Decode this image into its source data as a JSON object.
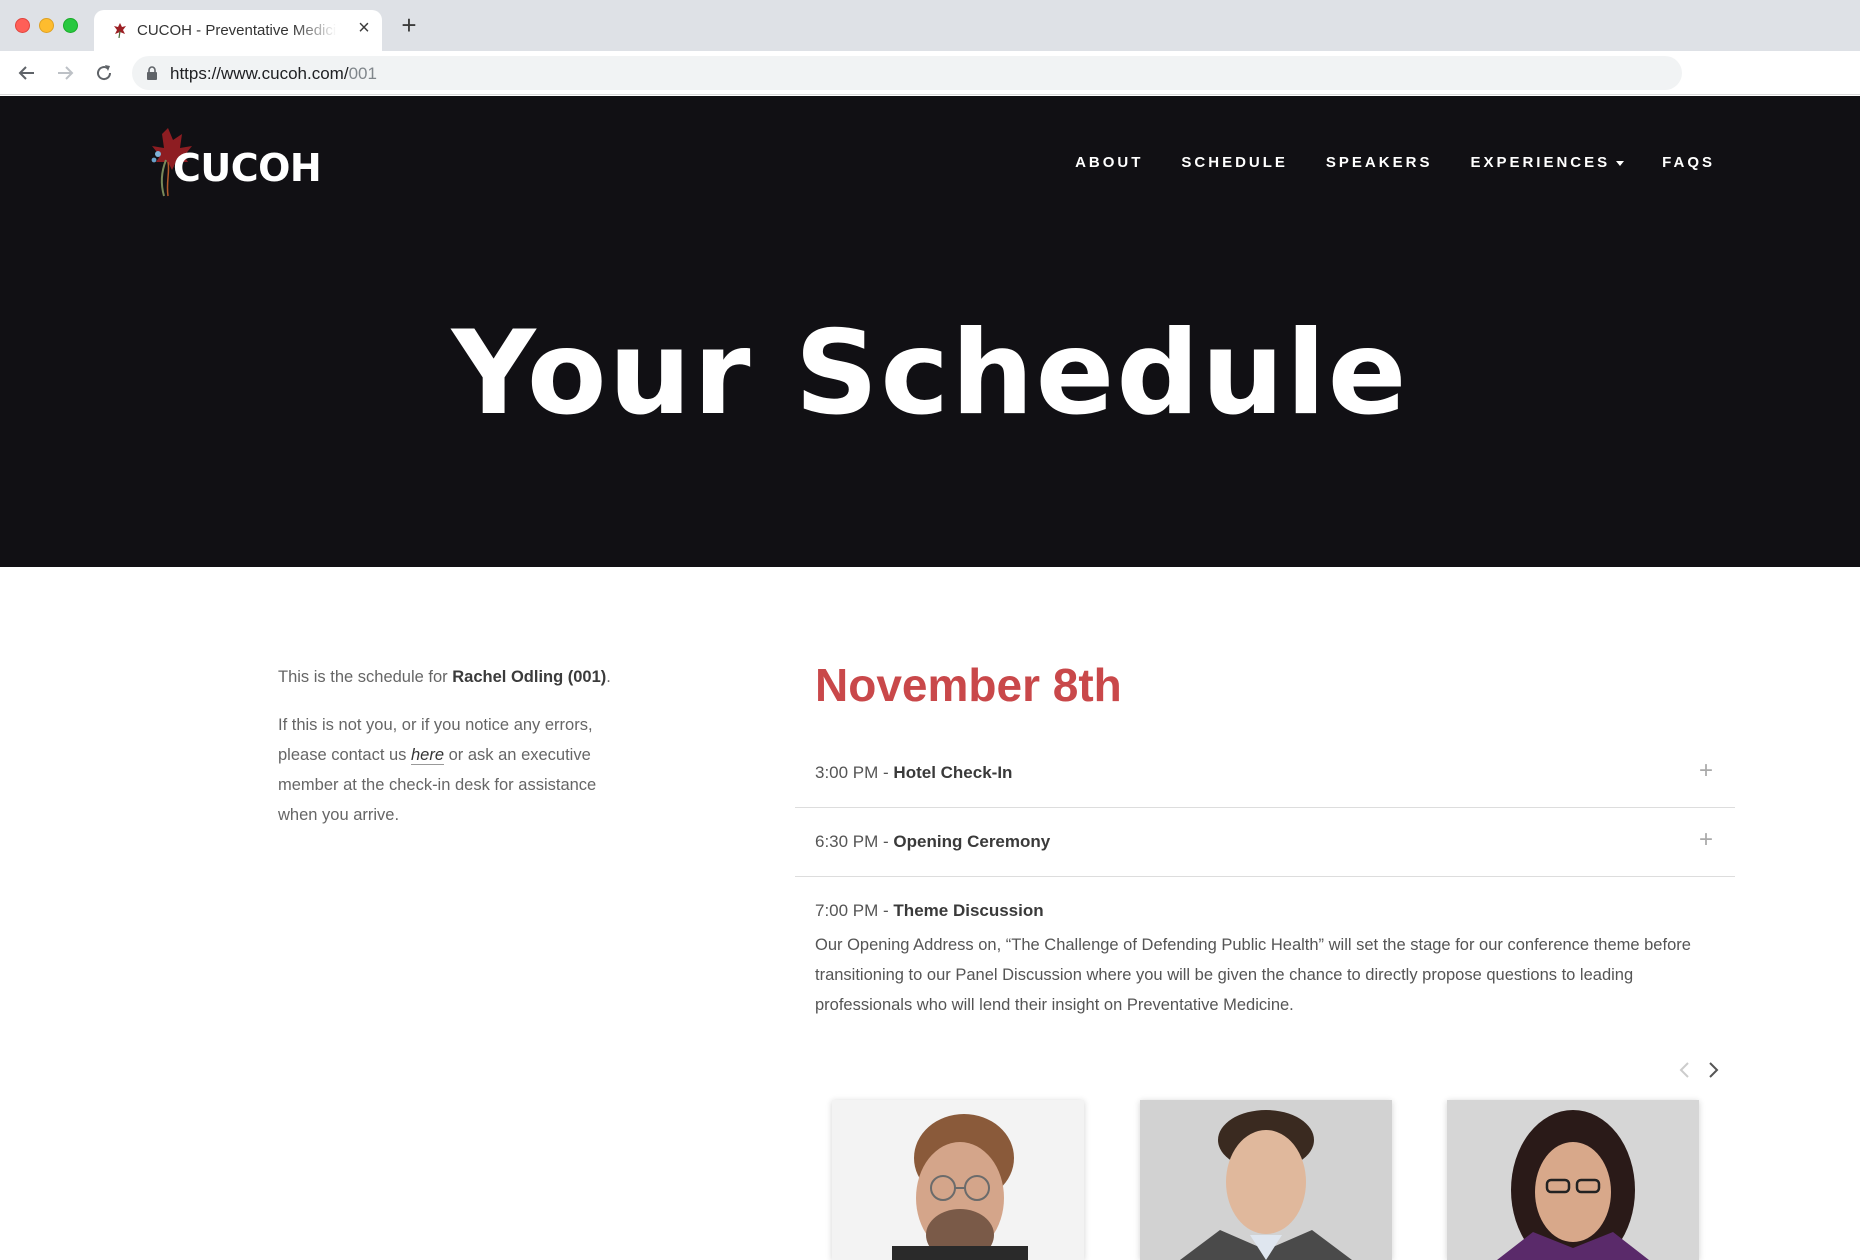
{
  "browser": {
    "tab_title": "CUCOH - Preventative Medicine",
    "url_host": "https://www.cucoh.com/",
    "url_path": "001"
  },
  "site": {
    "logo_text": "CUCOH",
    "nav": [
      {
        "label": "ABOUT"
      },
      {
        "label": "SCHEDULE"
      },
      {
        "label": "SPEAKERS"
      },
      {
        "label": "EXPERIENCES",
        "has_dropdown": true
      },
      {
        "label": "FAQS"
      }
    ],
    "hero_title": "Your Schedule"
  },
  "intro": {
    "line1_prefix": "This is the schedule for ",
    "attendee": "Rachel Odling (001)",
    "line1_suffix": ".",
    "line2_prefix": "If this is not you, or if you notice any errors, please contact us ",
    "contact_link": "here",
    "line2_suffix": " or ask an executive member at the check-in desk for assistance when you arrive."
  },
  "schedule": {
    "day": "November 8th",
    "events": [
      {
        "time": "3:00 PM - ",
        "title": "Hotel Check-In",
        "expanded": false
      },
      {
        "time": "6:30 PM - ",
        "title": "Opening Ceremony",
        "expanded": false
      },
      {
        "time": "7:00 PM - ",
        "title": "Theme Discussion",
        "expanded": true,
        "description": "Our Opening Address on, “The Challenge of Defending Public Health” will set the stage for our conference theme before transitioning to our Panel Discussion where you will be given the chance to directly propose questions to leading professionals who will lend their insight on Preventative Medicine."
      }
    ]
  },
  "colors": {
    "hero_bg": "#111014",
    "accent_red": "#c9484a"
  }
}
